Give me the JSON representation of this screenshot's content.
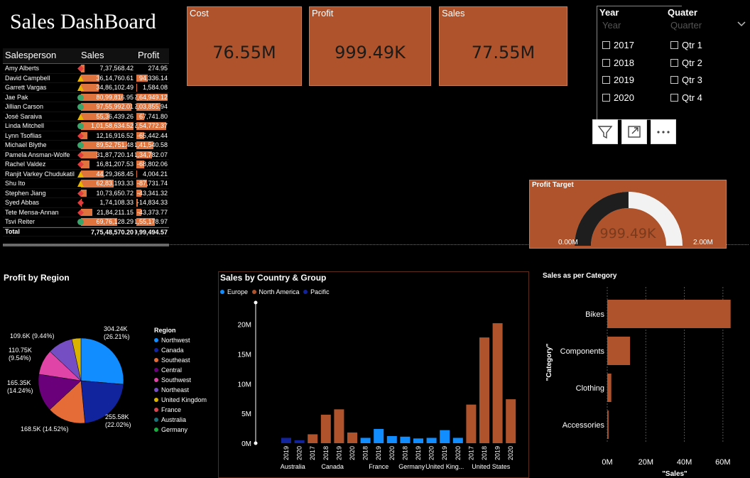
{
  "header": {
    "title": "Sales DashBoard"
  },
  "cards": [
    {
      "label": "Cost",
      "value": "76.55M"
    },
    {
      "label": "Profit",
      "value": "999.49K"
    },
    {
      "label": "Sales",
      "value": "77.55M"
    }
  ],
  "table": {
    "headers": [
      "Salesperson",
      "Sales",
      "Profit"
    ],
    "rows": [
      {
        "name": "Amy Alberts",
        "sales": "7,37,568.42",
        "profit": "274.95",
        "s": 7.4,
        "p": 0.3,
        "kpi": "diamond"
      },
      {
        "name": "David Campbell",
        "sales": "36,14,760.61",
        "profit": "94,336.14",
        "s": 36.1,
        "p": 94.3,
        "kpi": "triangle"
      },
      {
        "name": "Garrett Vargas",
        "sales": "34,86,102.49",
        "profit": "1,584.08",
        "s": 34.9,
        "p": 1.6,
        "kpi": "triangle"
      },
      {
        "name": "Jae Pak",
        "sales": "80,99,816.95",
        "profit": "2,64,949.12",
        "s": 81.0,
        "p": 264.9,
        "kpi": "circle"
      },
      {
        "name": "Jillian Carson",
        "sales": "97,55,992.01",
        "profit": "2,03,855.94",
        "s": 97.6,
        "p": 203.9,
        "kpi": "circle"
      },
      {
        "name": "José Saraiva",
        "sales": "55,36,439.26",
        "profit": "67,741.80",
        "s": 55.4,
        "p": 67.7,
        "kpi": "triangle"
      },
      {
        "name": "Linda Mitchell",
        "sales": "1,01,58,634.52",
        "profit": "2,54,772.37",
        "s": 101.6,
        "p": 254.8,
        "kpi": "circle"
      },
      {
        "name": "Lynn Tsoflias",
        "sales": "12,16,916.52",
        "profit": "-65,442.44",
        "s": 12.2,
        "p": -65.4,
        "kpi": "diamond"
      },
      {
        "name": "Michael Blythe",
        "sales": "89,52,751.48",
        "profit": "1,41,540.58",
        "s": 89.5,
        "p": 141.5,
        "kpi": "circle"
      },
      {
        "name": "Pamela Ansman-Wolfe",
        "sales": "31,87,720.14",
        "profit": "1,34,782.07",
        "s": 31.9,
        "p": 134.8,
        "kpi": "diamond"
      },
      {
        "name": "Rachel Valdez",
        "sales": "16,81,207.53",
        "profit": "-68,802.06",
        "s": 16.8,
        "p": -68.8,
        "kpi": "diamond"
      },
      {
        "name": "Ranjit Varkey Chudukatil",
        "sales": "44,29,368.45",
        "profit": "4,004.21",
        "s": 44.3,
        "p": 4.0,
        "kpi": "triangle"
      },
      {
        "name": "Shu Ito",
        "sales": "62,83,193.33",
        "profit": "-87,731.74",
        "s": 62.8,
        "p": -87.7,
        "kpi": "triangle"
      },
      {
        "name": "Stephen Jiang",
        "sales": "10,73,650.72",
        "profit": "-43,341.32",
        "s": 10.7,
        "p": -43.3,
        "kpi": "diamond"
      },
      {
        "name": "Syed Abbas",
        "sales": "1,74,108.33",
        "profit": "-14,834.33",
        "s": 1.7,
        "p": -14.8,
        "kpi": "diamond"
      },
      {
        "name": "Tete Mensa-Annan",
        "sales": "21,84,211.15",
        "profit": "-43,373.77",
        "s": 21.8,
        "p": -43.4,
        "kpi": "diamond"
      },
      {
        "name": "Tsvi Reiter",
        "sales": "69,76,128.29",
        "profit": "1,55,178.97",
        "s": 69.8,
        "p": 155.2,
        "kpi": "circle"
      }
    ],
    "total": {
      "label": "Total",
      "sales": "7,75,48,570.20",
      "profit": "9,99,494.57"
    }
  },
  "slicer": {
    "year_title": "Year",
    "year_placeholder": "Year",
    "years": [
      "2017",
      "2018",
      "2019",
      "2020"
    ],
    "quarter_title": "Quater",
    "quarter_placeholder": "Quarter",
    "quarters": [
      "Qtr 1",
      "Qtr 2",
      "Qtr 3",
      "Qtr 4"
    ],
    "chevron_icon": "chevron-down-icon"
  },
  "visual_buttons": [
    "filter-icon",
    "focus-mode-icon",
    "more-options-icon"
  ],
  "gauge": {
    "title": "Profit Target",
    "value": "999.49K",
    "min": "0.00M",
    "max": "2.00M",
    "fraction": 0.4997
  },
  "colors": {
    "card": "#ae532b",
    "bar": "#ae532b",
    "table_bar": "#e0743e",
    "europe": "#118dff",
    "north_america": "#ae532b",
    "pacific": "#12239e"
  },
  "chart_data": [
    {
      "type": "pie",
      "title": "Profit by Region",
      "legend_title": "Region",
      "legend": [
        "Northwest",
        "Canada",
        "Southeast",
        "Central",
        "Southwest",
        "Northeast",
        "United Kingdom",
        "France",
        "Australia",
        "Germany"
      ],
      "legend_colors": [
        "#118dff",
        "#12239e",
        "#e66c37",
        "#6b007b",
        "#e044a7",
        "#744ec2",
        "#d9b300",
        "#d64550",
        "#197278",
        "#1aab40"
      ],
      "slices": [
        {
          "name": "Northwest",
          "value": 304.24,
          "label": "304.24K\n(26.21%)",
          "color": "#118dff"
        },
        {
          "name": "Canada",
          "value": 255.58,
          "label": "255.58K\n(22.02%)",
          "color": "#12239e"
        },
        {
          "name": "Southeast",
          "value": 168.5,
          "label": "168.5K (14.52%)",
          "color": "#e66c37"
        },
        {
          "name": "Central",
          "value": 165.35,
          "label": "165.35K\n(14.24%)",
          "color": "#6b007b"
        },
        {
          "name": "Southwest",
          "value": 110.75,
          "label": "110.75K\n(9.54%)",
          "color": "#e044a7"
        },
        {
          "name": "Northeast",
          "value": 109.6,
          "label": "109.6K (9.44%)",
          "color": "#744ec2"
        },
        {
          "name": "United Kingdom",
          "value": 40.0,
          "label": "",
          "color": "#d9b300"
        }
      ]
    },
    {
      "type": "bar",
      "title": "Sales by Country & Group",
      "legend": [
        {
          "name": "Europe",
          "color": "#118dff"
        },
        {
          "name": "North America",
          "color": "#ae532b"
        },
        {
          "name": "Pacific",
          "color": "#12239e"
        }
      ],
      "yticks": [
        "0M",
        "5M",
        "10M",
        "15M",
        "20M"
      ],
      "ylim": [
        0,
        22
      ],
      "bars": [
        {
          "year": "2019",
          "value": 0.9,
          "group": "Pacific"
        },
        {
          "year": "2020",
          "value": 0.5,
          "group": "Pacific"
        },
        {
          "year": "2017",
          "value": 1.5,
          "group": "North America"
        },
        {
          "year": "2018",
          "value": 4.8,
          "group": "North America"
        },
        {
          "year": "2019",
          "value": 5.7,
          "group": "North America"
        },
        {
          "year": "2020",
          "value": 1.8,
          "group": "North America"
        },
        {
          "year": "2018",
          "value": 0.9,
          "group": "Europe"
        },
        {
          "year": "2019",
          "value": 2.4,
          "group": "Europe"
        },
        {
          "year": "2020",
          "value": 1.2,
          "group": "Europe"
        },
        {
          "year": "2018",
          "value": 1.1,
          "group": "Europe"
        },
        {
          "year": "2019",
          "value": 0.8,
          "group": "Europe"
        },
        {
          "year": "2020",
          "value": 0.9,
          "group": "Europe"
        },
        {
          "year": "2019",
          "value": 2.2,
          "group": "Europe"
        },
        {
          "year": "2020",
          "value": 0.9,
          "group": "Europe"
        },
        {
          "year": "2017",
          "value": 6.5,
          "group": "North America"
        },
        {
          "year": "2018",
          "value": 17.8,
          "group": "North America"
        },
        {
          "year": "2019",
          "value": 20.2,
          "group": "North America"
        },
        {
          "year": "2020",
          "value": 7.4,
          "group": "North America"
        }
      ],
      "countries": [
        {
          "name": "Australia",
          "from": 0,
          "to": 1
        },
        {
          "name": "Canada",
          "from": 2,
          "to": 5
        },
        {
          "name": "France",
          "from": 6,
          "to": 8
        },
        {
          "name": "Germany",
          "from": 9,
          "to": 10
        },
        {
          "name": "United King...",
          "from": 11,
          "to": 13
        },
        {
          "name": "United States",
          "from": 14,
          "to": 17
        }
      ]
    },
    {
      "type": "bar",
      "orientation": "horizontal",
      "title": "Sales as per Category",
      "xlabel": "\"Sales\"",
      "ylabel": "\"Category\"",
      "categories": [
        "Bikes",
        "Components",
        "Clothing",
        "Accessories"
      ],
      "values": [
        64.0,
        11.8,
        2.1,
        0.7
      ],
      "xticks": [
        "0M",
        "20M",
        "40M",
        "60M"
      ],
      "xlim": [
        0,
        70
      ]
    }
  ]
}
